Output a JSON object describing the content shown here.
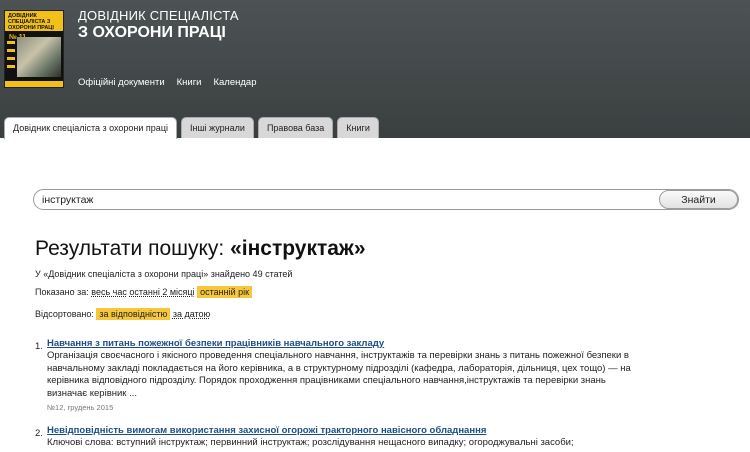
{
  "brand": {
    "line1": "ДОВІДНИК СПЕЦІАЛІСТА",
    "line2": "З ОХОРОНИ ПРАЦІ"
  },
  "cover": {
    "title": "ДОВІДНИК СПЕЦІАЛІСТА З ОХОРОНИ ПРАЦІ",
    "issue": "№ 11"
  },
  "topnav": [
    "Офіційні документи",
    "Книги",
    "Календар"
  ],
  "tabs": [
    {
      "label": "Довідник спеціаліста з охорони праці",
      "active": true
    },
    {
      "label": "Інші журнали",
      "active": false
    },
    {
      "label": "Правова база",
      "active": false
    },
    {
      "label": "Книги",
      "active": false
    }
  ],
  "search": {
    "value": "інструктаж",
    "button": "Знайти"
  },
  "results_header": {
    "prefix": "Результати пошуку: ",
    "query": "«інструктаж»",
    "found": "У «Довідник спеціаліста з охорони праці» знайдено 49 статей",
    "shown_label": "Показано за:",
    "shown_options": [
      "весь час",
      "останні 2 місяці",
      "останній рік"
    ],
    "sorted_label": "Відсортовано:",
    "sorted_options": [
      "за відповідністю",
      "за датою"
    ]
  },
  "results": [
    {
      "num": "1.",
      "title": "Навчання з питань пожежної безпеки працівників навчального закладу",
      "snippet": "Організація своєчасного і якісного проведення спеціального навчання, інструктажів та перевірки знань з питань пожежної безпеки в навчальному закладі покладається на його керівника, а в структурному підрозділі (кафедра, лабораторія, дільниця, цех тощо) — на керівника відповідного підрозділу. Порядок проходження працівниками спеціального навчання,інструктажів та перевірки знань визначає керівник ...",
      "date": "№12, грудень 2015"
    },
    {
      "num": "2.",
      "title": "Невідповідність вимогам використання захисної огорожі тракторного навісного обладнання",
      "snippet": "Ключові слова: вступний інструктаж; первинний інструктаж; розслідування нещасного випадку; огороджувальні засоби;",
      "date": ""
    }
  ]
}
